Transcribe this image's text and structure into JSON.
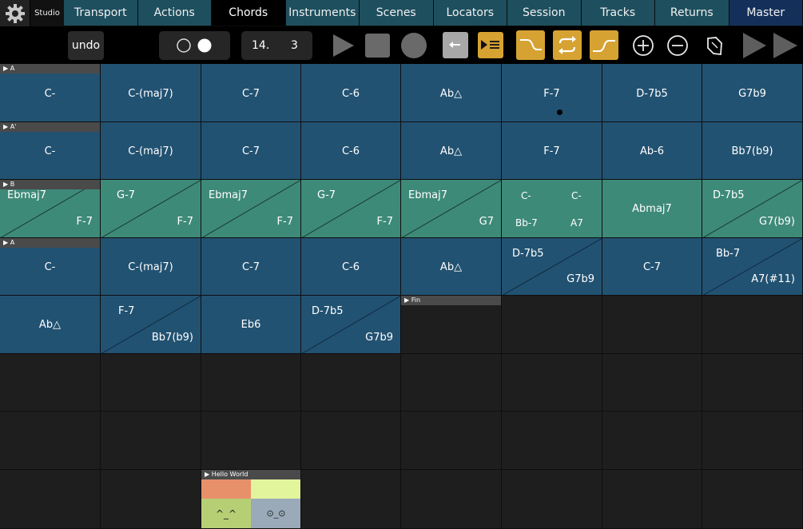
{
  "tabs": {
    "studio": "Studio",
    "items": [
      "Transport",
      "Actions",
      "Chords",
      "Instruments",
      "Scenes",
      "Locators",
      "Session",
      "Tracks",
      "Returns",
      "Master"
    ],
    "active": "Chords"
  },
  "toolbar": {
    "undo": "undo",
    "position_bar": "14.",
    "position_beat": "3"
  },
  "sections": {
    "a": "A",
    "a2": "A'",
    "b": "B",
    "a3": "A",
    "fin": "Fin",
    "hello": "Hello World"
  },
  "rows": {
    "r1": [
      "C-",
      "C-(maj7)",
      "C-7",
      "C-6",
      "Ab△",
      "F-7",
      "D-7b5",
      "G7b9"
    ],
    "r2": [
      "C-",
      "C-(maj7)",
      "C-7",
      "C-6",
      "Ab△",
      "F-7",
      "Ab-6",
      "Bb7(b9)"
    ],
    "r3": [
      {
        "top": "Ebmaj7",
        "bottom": "F-7"
      },
      {
        "top": "G-7",
        "bottom": "F-7"
      },
      {
        "top": "Ebmaj7",
        "bottom": "F-7"
      },
      {
        "top": "G-7",
        "bottom": "F-7"
      },
      {
        "top": "Ebmaj7",
        "bottom": "G7"
      },
      {
        "q1": "C-",
        "q2": "C-",
        "q3": "Bb-7",
        "q4": "A7"
      },
      {
        "single": "Abmaj7"
      },
      {
        "top": "D-7b5",
        "bottom": "G7(b9)"
      }
    ],
    "r4": [
      {
        "single": "C-"
      },
      {
        "single": "C-(maj7)"
      },
      {
        "single": "C-7"
      },
      {
        "single": "C-6"
      },
      {
        "single": "Ab△"
      },
      {
        "top": "D-7b5",
        "bottom": "G7b9"
      },
      {
        "single": "C-7"
      },
      {
        "top": "Bb-7",
        "bottom": "A7(#11)"
      }
    ],
    "r5": [
      {
        "single": "Ab△"
      },
      {
        "top": "F-7",
        "bottom": "Bb7(b9)"
      },
      {
        "single": "Eb6"
      },
      {
        "top": "D-7b5",
        "bottom": "G7b9"
      }
    ]
  },
  "hello_world": {
    "face1": "^_^",
    "face2": "⊙_⊙",
    "colors": [
      "#e8906a",
      "#e2f59c",
      "#b6cf74",
      "#9aaab8"
    ]
  },
  "colors": {
    "blue": "#225272",
    "green": "#3e8a78",
    "gold": "#d6a232",
    "tab": "#1e4f5e",
    "master": "#14305a"
  }
}
